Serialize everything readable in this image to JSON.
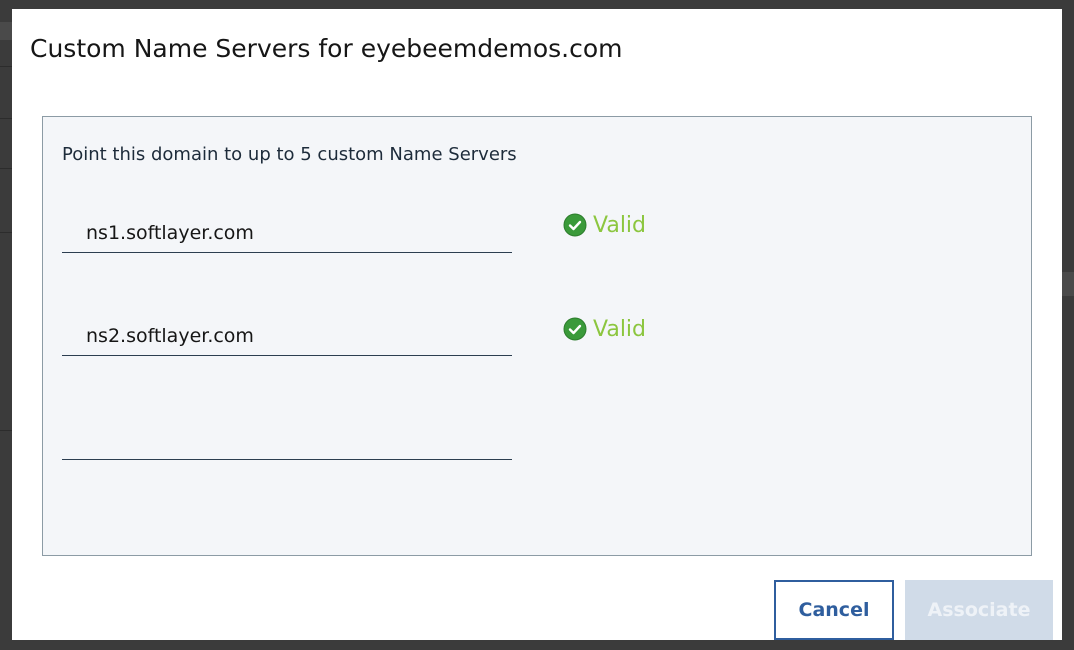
{
  "dialog": {
    "title": "Custom Name Servers for eyebeemdemos.com",
    "description": "Point this domain to up to 5 custom Name Servers",
    "name_servers": [
      {
        "value": "ns1.softlayer.com",
        "status": "Valid",
        "status_icon": "check-circle-icon"
      },
      {
        "value": "ns2.softlayer.com",
        "status": "Valid",
        "status_icon": "check-circle-icon"
      },
      {
        "value": ""
      }
    ],
    "buttons": {
      "cancel": "Cancel",
      "associate": "Associate"
    },
    "colors": {
      "valid": "#8cc63f",
      "primary": "#2f5e9e",
      "disabled_button": "#d0dbe8"
    }
  }
}
